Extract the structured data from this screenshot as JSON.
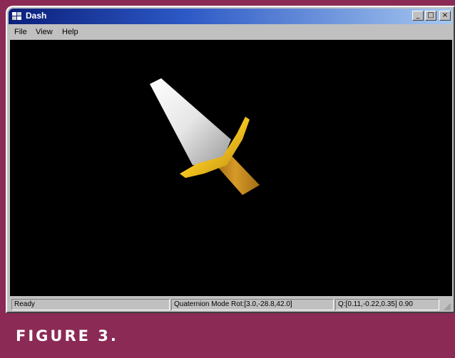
{
  "window": {
    "title": "Dash",
    "buttons": {
      "minimize": "_",
      "maximize": "□",
      "close": "×"
    }
  },
  "menu": {
    "items": [
      "File",
      "View",
      "Help"
    ]
  },
  "viewport": {
    "background": "#000000",
    "object": "dagger"
  },
  "status": {
    "message": "Ready",
    "mode": "Quaternion Mode  Rot:[3.0,-28.8,42.0]",
    "quaternion": "Q:[0.11,-0.22,0.35] 0.90"
  },
  "caption": "FIGURE 3.",
  "colors": {
    "frame": "#8a2a55",
    "titlebar": "#0a1f7a",
    "blade": "#e8e8e8",
    "guard": "#f2c21f",
    "handle": "#c98a1a"
  }
}
